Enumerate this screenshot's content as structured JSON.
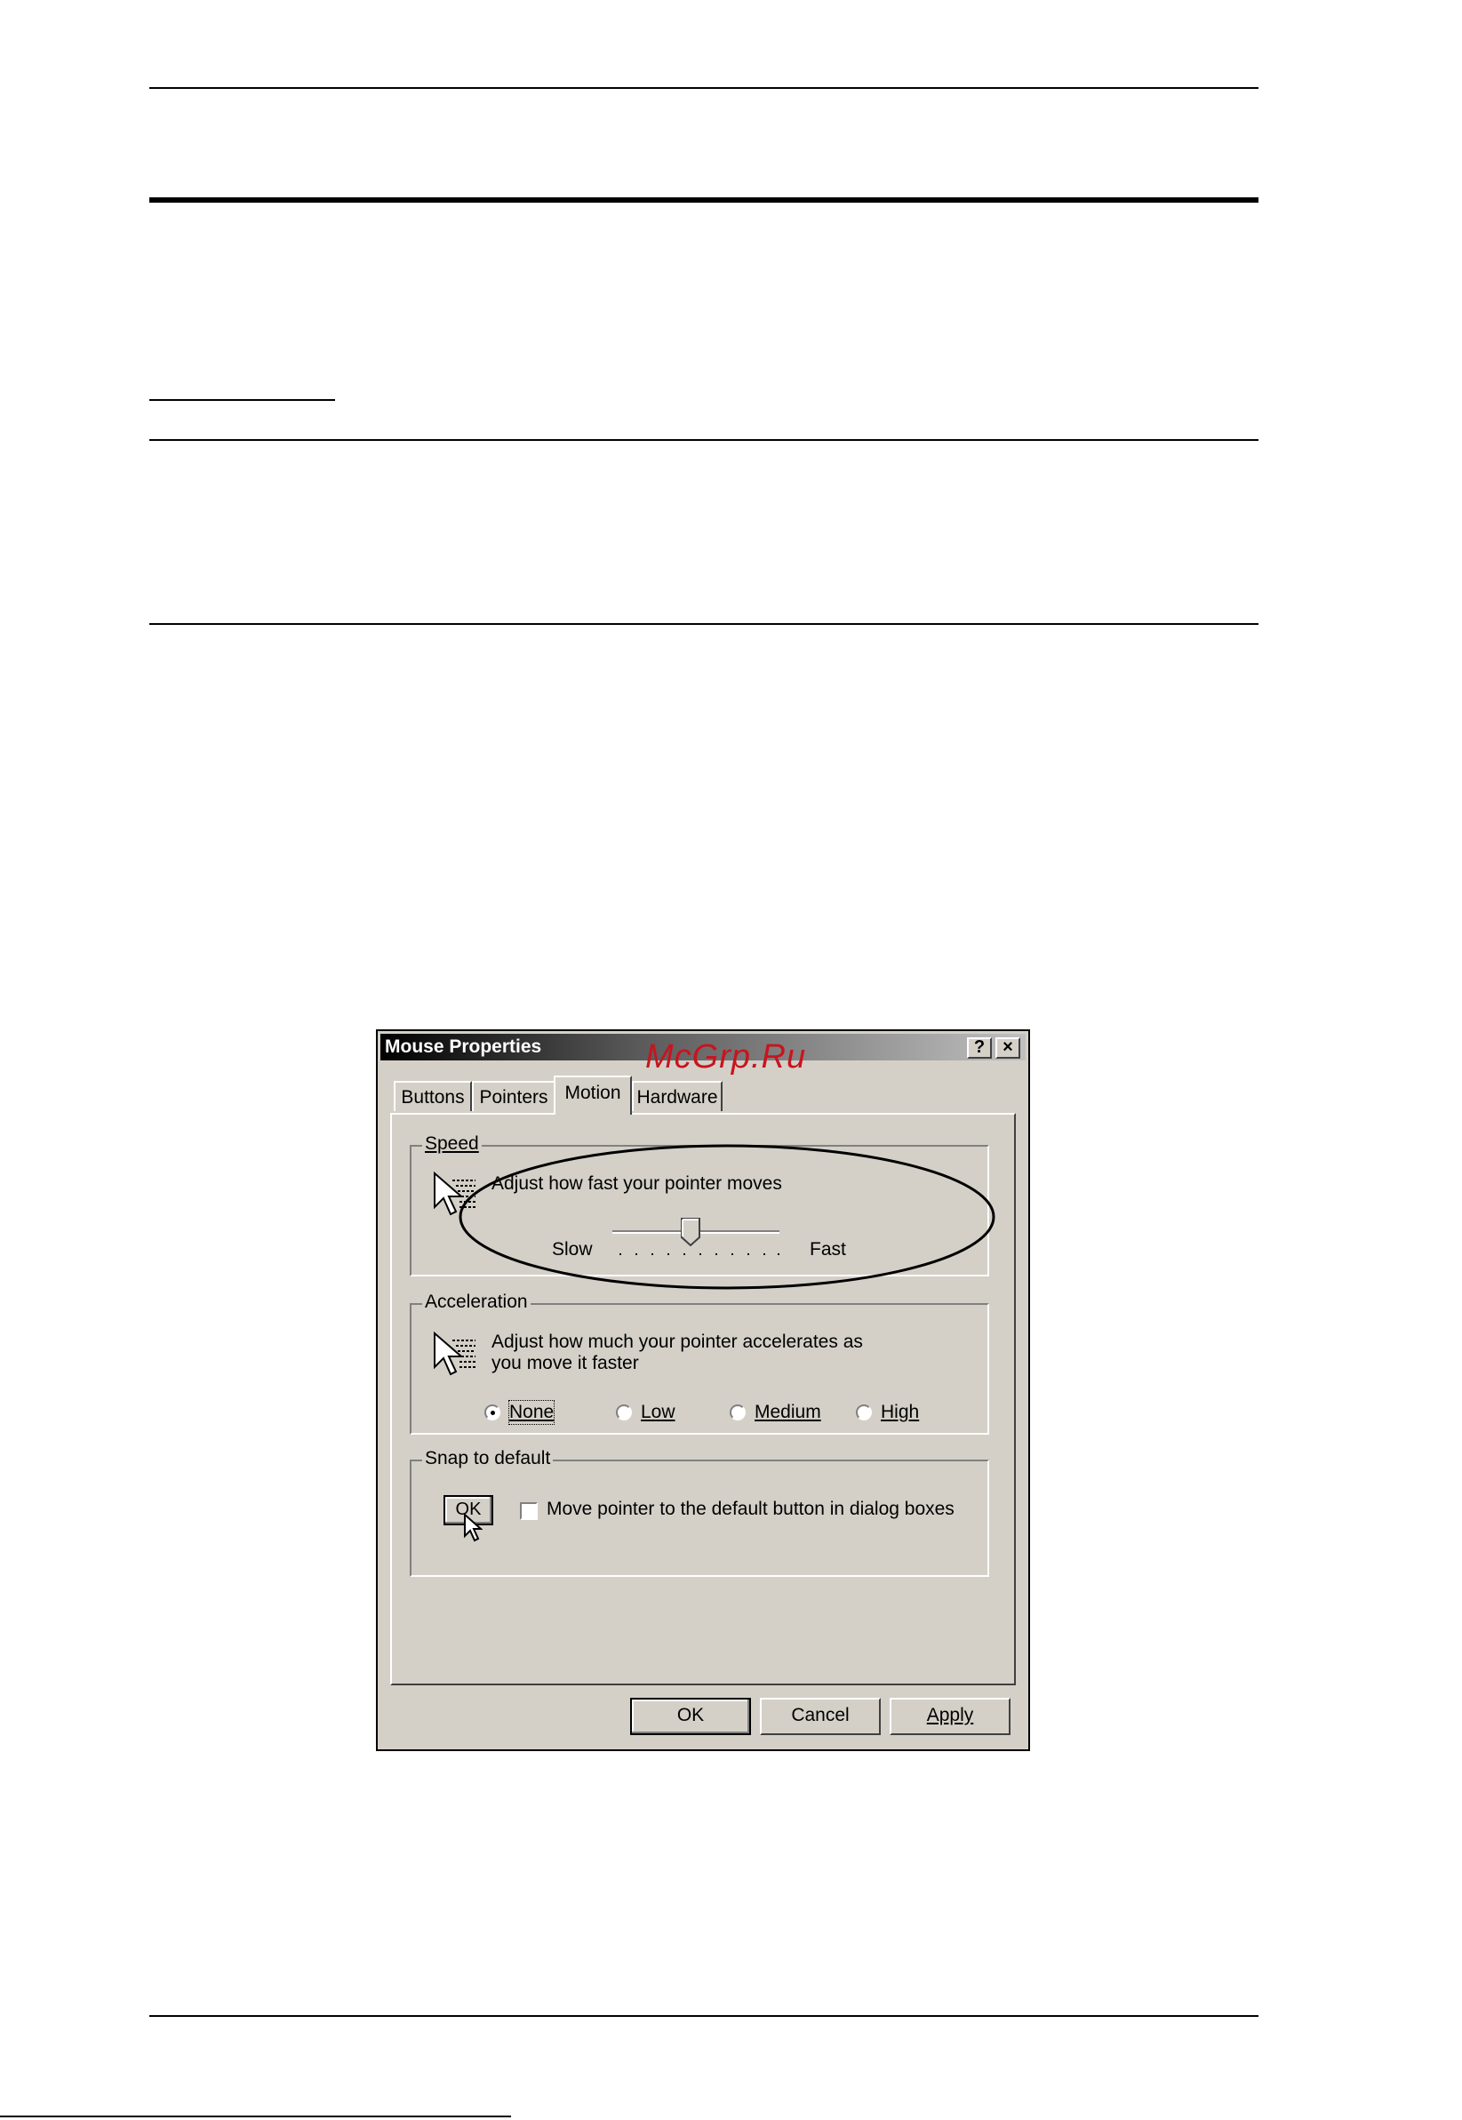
{
  "watermark": "McGrp.Ru",
  "dialog": {
    "title": "Mouse Properties",
    "help_button": "?",
    "close_button": "×",
    "tabs": [
      {
        "label": "Buttons",
        "active": false
      },
      {
        "label": "Pointers",
        "active": false
      },
      {
        "label": "Motion",
        "active": true
      },
      {
        "label": "Hardware",
        "active": false
      }
    ],
    "speed": {
      "legend": "Speed",
      "description": "Adjust how fast your pointer moves",
      "slow_label": "Slow",
      "fast_label": "Fast",
      "slider_position_fraction": 0.5
    },
    "acceleration": {
      "legend": "Acceleration",
      "description_line1": "Adjust how much your pointer accelerates as",
      "description_line2": "you move it faster",
      "options": [
        {
          "label": "None",
          "selected": true
        },
        {
          "label": "Low",
          "selected": false
        },
        {
          "label": "Medium",
          "selected": false
        },
        {
          "label": "High",
          "selected": false
        }
      ]
    },
    "snap": {
      "legend": "Snap to default",
      "sample_button": "OK",
      "checkbox_label": "Move pointer to the default button in dialog boxes",
      "checked": false
    },
    "buttons": {
      "ok": "OK",
      "cancel": "Cancel",
      "apply": "Apply"
    }
  },
  "colors": {
    "dialog_face": "#d4d0c8",
    "watermark": "#c8141e"
  }
}
